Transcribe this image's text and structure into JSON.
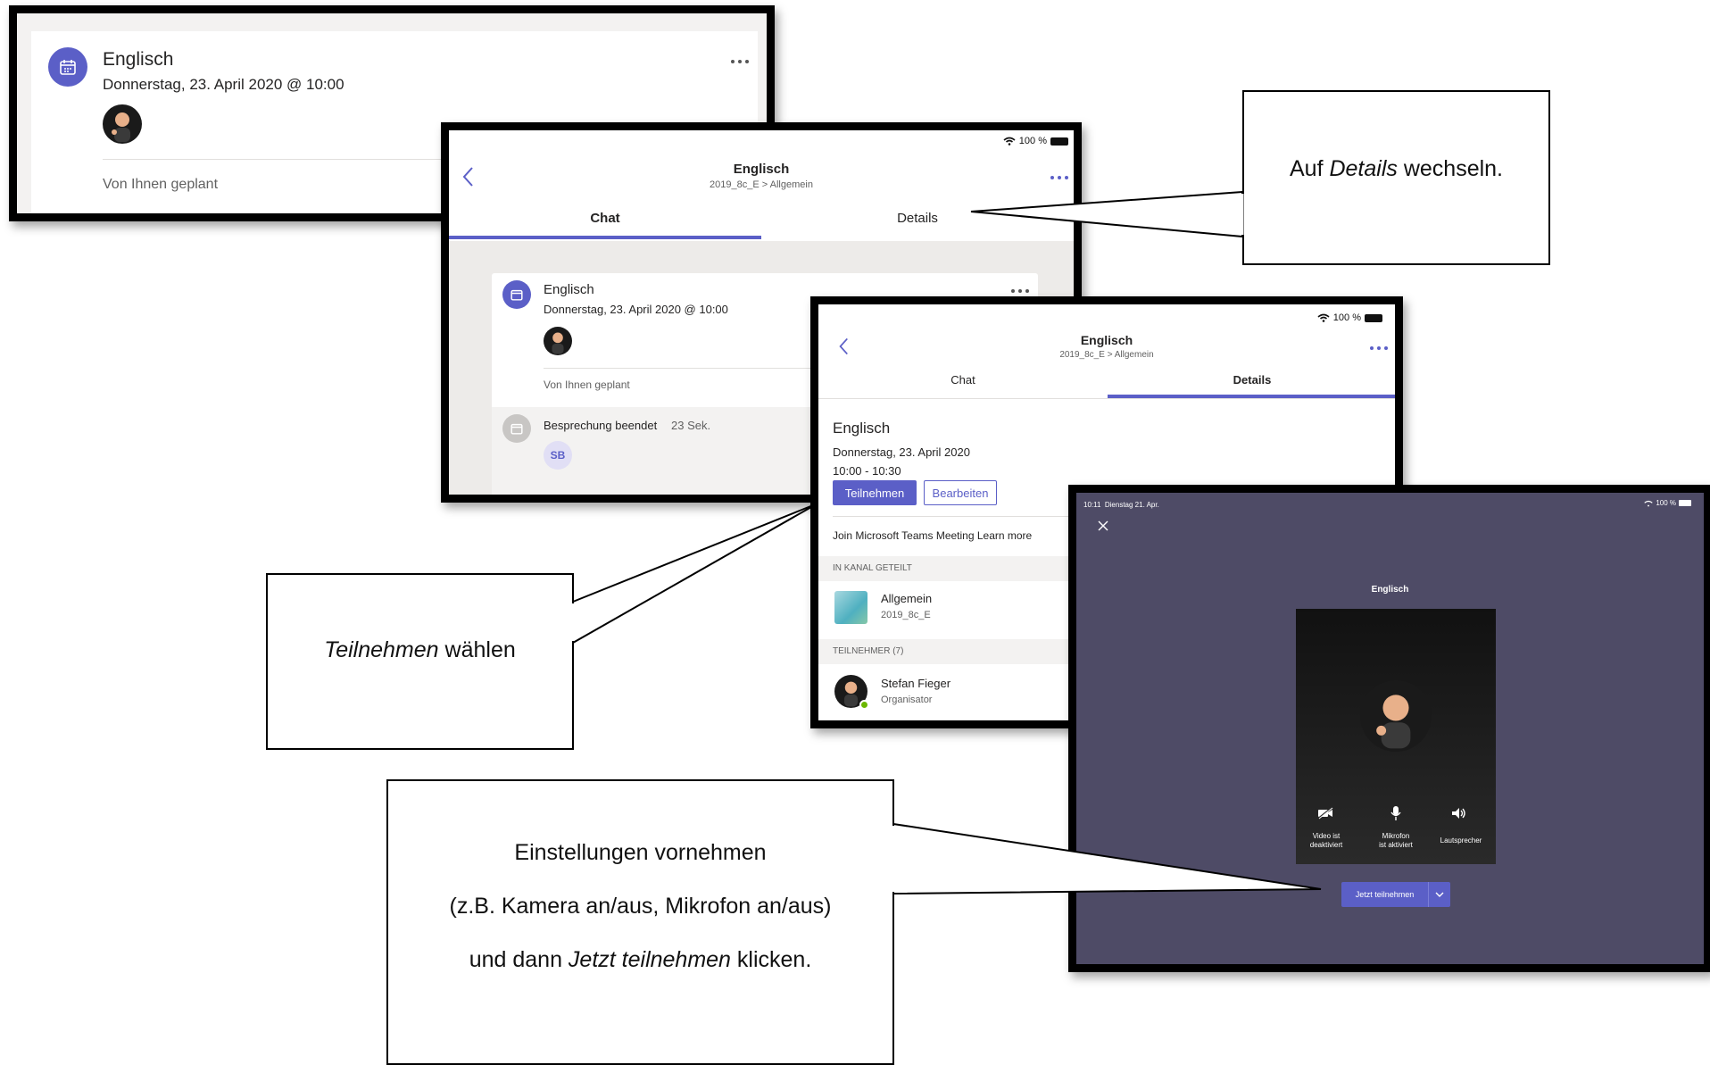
{
  "shot1": {
    "title": "Englisch",
    "date": "Donnerstag, 23. April 2020 @ 10:00",
    "planned": "Von Ihnen geplant"
  },
  "shot2": {
    "status": "100 %",
    "title": "Englisch",
    "subtitle": "2019_8c_E > Allgemein",
    "tab_chat": "Chat",
    "tab_details": "Details",
    "card_title": "Englisch",
    "card_date": "Donnerstag, 23. April 2020 @ 10:00",
    "card_planned": "Von Ihnen geplant",
    "ended_label": "Besprechung beendet",
    "ended_duration": "23 Sek.",
    "initials": "SB"
  },
  "shot3": {
    "status": "100 %",
    "title": "Englisch",
    "subtitle": "2019_8c_E > Allgemein",
    "tab_chat": "Chat",
    "tab_details": "Details",
    "meeting_title": "Englisch",
    "meeting_date": "Donnerstag, 23. April 2020",
    "meeting_time": "10:00 - 10:30",
    "join_button": "Teilnehmen",
    "edit_button": "Bearbeiten",
    "join_link_text": "Join Microsoft Teams Meeting Learn more",
    "section_channel": "IN KANAL GETEILT",
    "channel_name": "Allgemein",
    "channel_team": "2019_8c_E",
    "section_participants": "TEILNEHMER (7)",
    "participant_name": "Stefan Fieger",
    "participant_role": "Organisator"
  },
  "shot4": {
    "status_left": "10:11  Dienstag 21. Apr.",
    "status_right": "100 %",
    "meeting_name": "Englisch",
    "video_label_1": "Video ist",
    "video_label_2": "deaktiviert",
    "mic_label_1": "Mikrofon",
    "mic_label_2": "ist aktiviert",
    "speaker_label": "Lautsprecher",
    "join_now": "Jetzt teilnehmen"
  },
  "callouts": {
    "details_pre": "Auf ",
    "details_em": "Details",
    "details_post": " wechseln.",
    "join_em": "Teilnehmen",
    "join_post": " wählen",
    "settings_line1": "Einstellungen vornehmen",
    "settings_line2": "(z.B. Kamera an/aus, Mikrofon an/aus)",
    "settings_line3_pre": "und dann ",
    "settings_line3_em": "Jetzt teilnehmen",
    "settings_line3_post": " klicken."
  },
  "colors": {
    "teams_purple": "#5b5fc7",
    "dark_bg": "#4e4b66",
    "video_bg": "#1f1f1f"
  }
}
